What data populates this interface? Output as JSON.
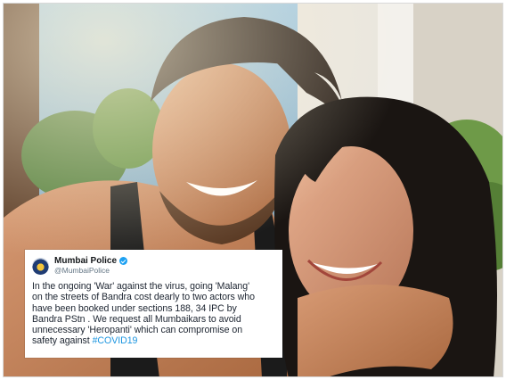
{
  "tweet": {
    "account_name": "Mumbai Police",
    "handle": "@MumbaiPolice",
    "text": "In  the ongoing  'War' against the virus, going 'Malang'\non the streets of Bandra cost dearly to two actors who\nhave been booked under sections 188, 34 IPC by\nBandra PStn . We request all Mumbaikars to avoid\nunnecessary 'Heropanti' which can compromise on\nsafety against ",
    "hashtag": "#COVID19",
    "colors": {
      "hashtag": "#1b95e0",
      "verified_badge": "#1da1f2"
    },
    "icons": [
      "avatar-logo",
      "verified-icon"
    ]
  }
}
